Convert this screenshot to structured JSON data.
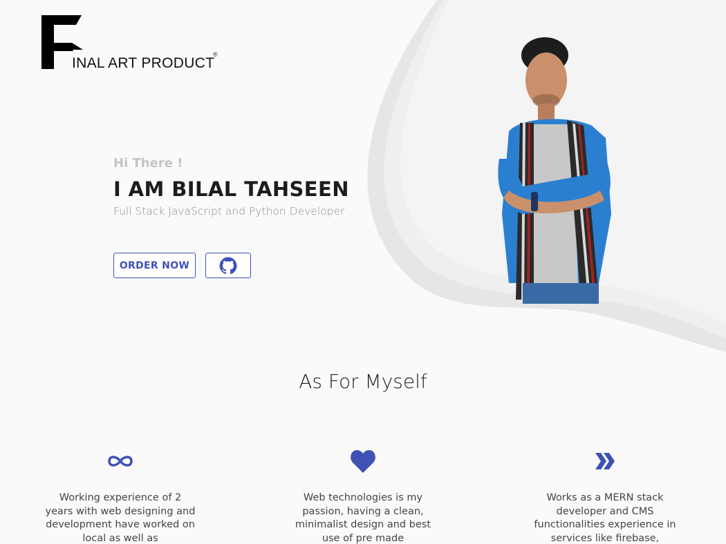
{
  "brand": {
    "logo_letter": "F",
    "logo_text": "INAL ART PRODUCT",
    "registered_mark": "®"
  },
  "hero": {
    "greeting": "Hi There !",
    "name": "I AM BILAL TAHSEEN",
    "role": "Full Stack JavaScript and Python Developer",
    "order_button": "ORDER NOW",
    "github_icon": "github-icon"
  },
  "about": {
    "title": "As For Myself",
    "features": [
      {
        "icon": "infinity-icon",
        "text": "Working experience of 2 years with web designing and development have worked on local as well as"
      },
      {
        "icon": "heart-icon",
        "text": "Web technologies is my passion, having a clean, minimalist design and best use of pre made"
      },
      {
        "icon": "double-chevron-right-icon",
        "text": "Works as a MERN stack developer and CMS functionalities experience in services like firebase,"
      }
    ]
  },
  "colors": {
    "accent": "#3f51b5",
    "background": "#fafafa",
    "wave": "#ececec"
  }
}
